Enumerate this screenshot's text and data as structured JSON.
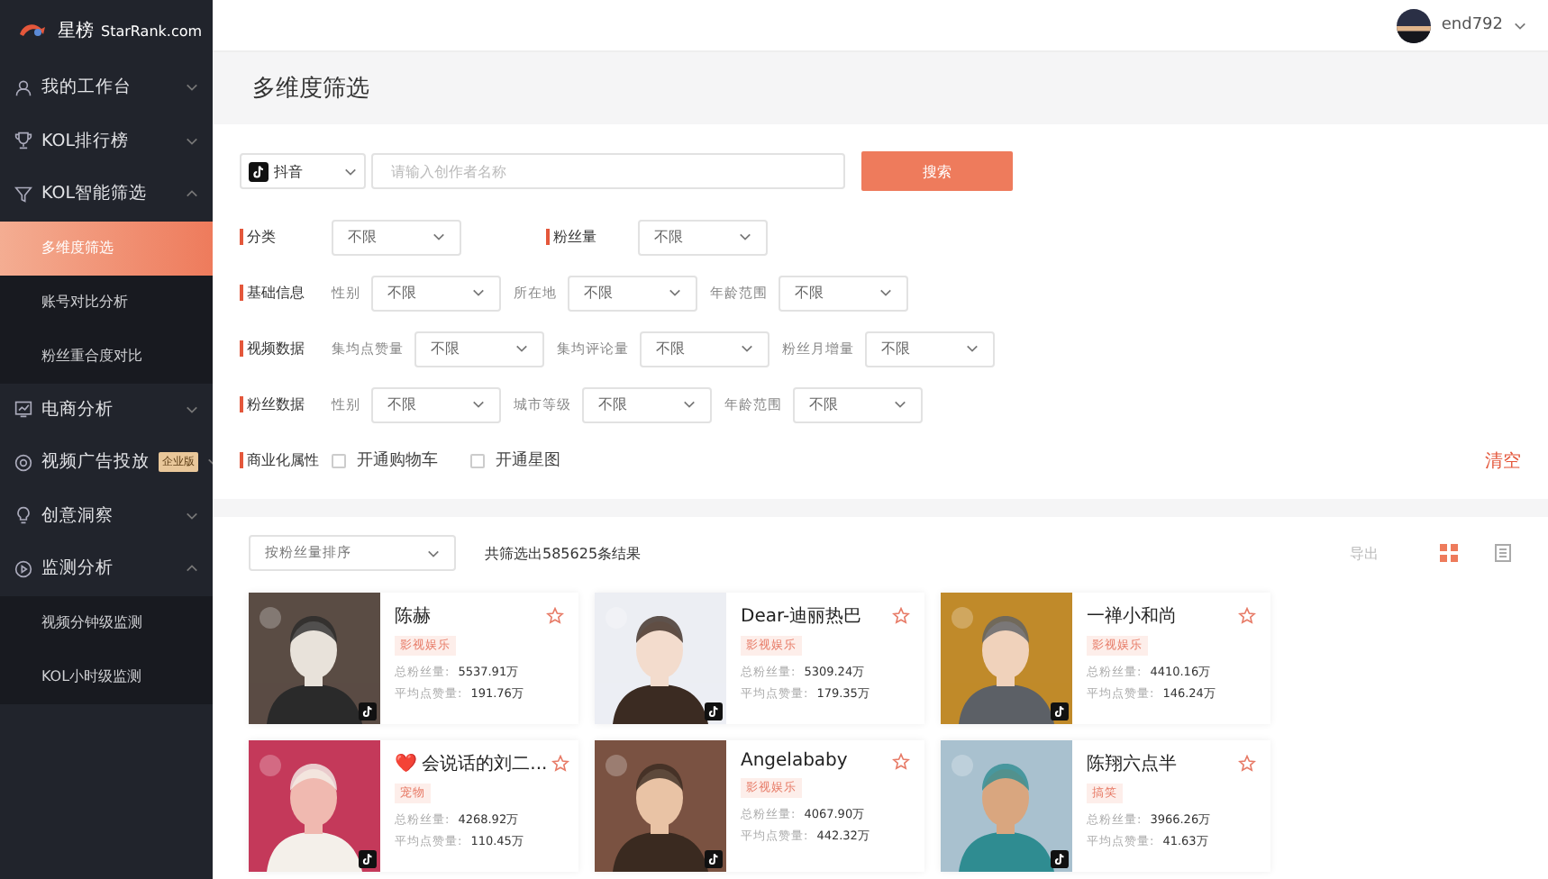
{
  "brand": {
    "name": "星榜",
    "domain": "StarRank.com"
  },
  "user": {
    "name": "end792"
  },
  "sidebar": {
    "items": [
      {
        "label": "我的工作台",
        "expanded": false
      },
      {
        "label": "KOL排行榜",
        "expanded": false
      },
      {
        "label": "KOL智能筛选",
        "expanded": true,
        "children": [
          {
            "label": "多维度筛选",
            "selected": true
          },
          {
            "label": "账号对比分析",
            "selected": false
          },
          {
            "label": "粉丝重合度对比",
            "selected": false
          }
        ]
      },
      {
        "label": "电商分析",
        "expanded": false
      },
      {
        "label": "视频广告投放",
        "badge": "企业版",
        "expanded": false
      },
      {
        "label": "创意洞察",
        "expanded": false
      },
      {
        "label": "监测分析",
        "expanded": true,
        "children": [
          {
            "label": "视频分钟级监测",
            "selected": false
          },
          {
            "label": "KOL小时级监测",
            "selected": false
          }
        ]
      }
    ]
  },
  "page_title": "多维度筛选",
  "search": {
    "platform": "抖音",
    "placeholder": "请输入创作者名称",
    "button": "搜索"
  },
  "filter_rows": [
    {
      "groups": [
        {
          "title": "分类",
          "fields": [
            {
              "kind": "select",
              "value": "不限"
            }
          ]
        },
        {
          "title": "粉丝量",
          "fields": [
            {
              "kind": "select",
              "value": "不限"
            }
          ]
        }
      ]
    },
    {
      "groups": [
        {
          "title": "基础信息",
          "fields": [
            {
              "kind": "select",
              "label": "性别",
              "value": "不限"
            },
            {
              "kind": "select",
              "label": "所在地",
              "value": "不限"
            },
            {
              "kind": "select",
              "label": "年龄范围",
              "value": "不限"
            }
          ]
        }
      ]
    },
    {
      "groups": [
        {
          "title": "视频数据",
          "fields": [
            {
              "kind": "select",
              "label": "集均点赞量",
              "value": "不限"
            },
            {
              "kind": "select",
              "label": "集均评论量",
              "value": "不限"
            },
            {
              "kind": "select",
              "label": "粉丝月增量",
              "value": "不限"
            }
          ]
        }
      ]
    },
    {
      "groups": [
        {
          "title": "粉丝数据",
          "fields": [
            {
              "kind": "select",
              "label": "性别",
              "value": "不限"
            },
            {
              "kind": "select",
              "label": "城市等级",
              "value": "不限"
            },
            {
              "kind": "select",
              "label": "年龄范围",
              "value": "不限"
            }
          ]
        }
      ]
    },
    {
      "groups": [
        {
          "title": "商业化属性",
          "fields": [
            {
              "kind": "checkbox",
              "label": "开通购物车",
              "checked": false
            },
            {
              "kind": "checkbox",
              "label": "开通星图",
              "checked": false
            }
          ]
        }
      ]
    }
  ],
  "clear": "清空",
  "results": {
    "sort": "按粉丝量排序",
    "count": "共筛选出585625条结果",
    "export": "导出",
    "views": [
      {
        "kind": "grid",
        "selected": true
      },
      {
        "kind": "list",
        "selected": false
      }
    ]
  },
  "cards": [
    {
      "name": "陈赫",
      "tag": "影视娱乐",
      "stats": [
        {
          "label": "总粉丝量:",
          "value": "5537.91万"
        },
        {
          "label": "平均点赞量:",
          "value": "191.76万"
        }
      ]
    },
    {
      "name": "Dear-迪丽热巴",
      "tag": "影视娱乐",
      "stats": [
        {
          "label": "总粉丝量:",
          "value": "5309.24万"
        },
        {
          "label": "平均点赞量:",
          "value": "179.35万"
        }
      ]
    },
    {
      "name": "一禅小和尚",
      "tag": "影视娱乐",
      "stats": [
        {
          "label": "总粉丝量:",
          "value": "4410.16万"
        },
        {
          "label": "平均点赞量:",
          "value": "146.24万"
        }
      ]
    },
    {
      "name": "❤️ 会说话的刘二...",
      "tag": "宠物",
      "stats": [
        {
          "label": "总粉丝量:",
          "value": "4268.92万"
        },
        {
          "label": "平均点赞量:",
          "value": "110.45万"
        }
      ]
    },
    {
      "name": "Angelababy",
      "tag": "影视娱乐",
      "stats": [
        {
          "label": "总粉丝量:",
          "value": "4067.90万"
        },
        {
          "label": "平均点赞量:",
          "value": "442.32万"
        }
      ]
    },
    {
      "name": "陈翔六点半",
      "tag": "搞笑",
      "stats": [
        {
          "label": "总粉丝量:",
          "value": "3966.26万"
        },
        {
          "label": "平均点赞量:",
          "value": "41.63万"
        }
      ]
    }
  ]
}
